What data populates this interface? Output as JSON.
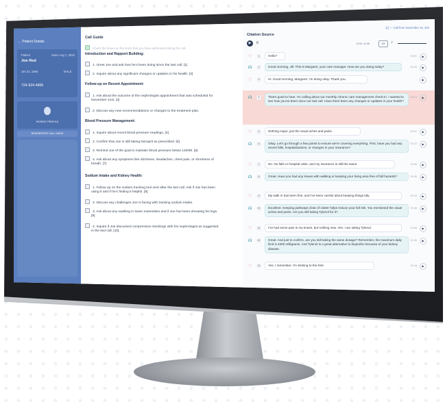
{
  "patient_panel": {
    "header": "Patient Details",
    "patient_label": "Patient",
    "patient_name": "Joe Red",
    "since": "Since Aug 7, 2024",
    "phone": "724-924-4865",
    "dob": "Jan 22, 1956",
    "gender": "MALE",
    "profile_label": "PATIENT PROFILE",
    "regen_label": "REGENERATE CALL GUIDE"
  },
  "call_guide": {
    "title": "Call Guide",
    "top_item": "Check the boxes as the items that you have addressed during the call",
    "sections": [
      {
        "heading": "Introduction and Rapport Building:",
        "items": [
          "1. Greet Joe and ask how he's been doing since the last call. [1]",
          "2. Inquire about any significant changes or updates in his health. [2]"
        ]
      },
      {
        "heading": "Follow-up on Recent Appointment:",
        "items": [
          "1. Ask about the outcome of the nephrologist appointment that was scheduled for",
          "November 21st. [3]",
          "2. Discuss any new recommendations or changes to the treatment plan."
        ]
      },
      {
        "heading": "Blood Pressure Management:",
        "items": [
          "1. Inquire about recent blood pressure readings. [4]",
          "2. Confirm that Joe is still taking lisinopril as prescribed. [5]",
          "3. Remind Joe of the goal to maintain blood pressure below 140/90. [6]",
          "4. Ask about any symptoms like dizziness, headaches, chest pain, or shortness of",
          "breath. [7]"
        ]
      },
      {
        "heading": "Sodium Intake and Kidney Health:",
        "items": [
          "1. Follow up on the sodium tracking tool sent after the last call. Ask if Joe has been",
          "using it and if he's finding it helpful. [8]",
          "2. Discuss any challenges Joe is facing with tracking sodium intake.",
          "3. Ask about any swelling in lower extremities and if Joe has been elevating his legs.",
          "[9]",
          "4. Inquire if Joe discussed compression stockings with his nephrologist as suggested",
          "in the last call. [10]"
        ]
      }
    ]
  },
  "citation": {
    "title": "Citation Source",
    "from": "[1] — Call from November 15, 202",
    "player": {
      "play": "▶",
      "pos": "0",
      "time": "0:00 / 6:26",
      "speed": "1X",
      "volume": "♪"
    },
    "messages": [
      {
        "n": "1",
        "who": "cust",
        "text": "Hello?",
        "t": "00:01"
      },
      {
        "n": "2",
        "who": "agent",
        "text": "Good morning, Jill. This is Margaret, your care manager. How are you doing today?",
        "t": "00:05"
      },
      {
        "n": "3",
        "who": "cust",
        "text": "Hi. Good morning, Margaret. I'm doing okay. Thank you.",
        "t": ""
      },
      {
        "n": "4",
        "who": "agent",
        "text": "That's good to hear. I'm calling about our monthly chronic care management check-in. I wanted to see how you've been since our last call. Have there been any changes or updates in your health?",
        "t": "00:10"
      },
      {
        "n": "5",
        "who": "cust",
        "text": "Nothing major, just the usual aches and pains.",
        "t": "00:22"
      },
      {
        "n": "6",
        "who": "agent",
        "text": "Okay. Let's go through a few points to ensure we're covering everything. First, have you had any recent falls, hospitalizations, or changes in your insurance?",
        "t": "00:23"
      },
      {
        "n": "7",
        "who": "cust",
        "text": "No. No falls or hospital visits, and my insurance is still the same.",
        "t": "00:30"
      },
      {
        "n": "8",
        "who": "agent",
        "text": "Great. Have you had any issues with walking or keeping your living area free of fall hazards?",
        "t": "00:36"
      },
      {
        "n": "9",
        "who": "cust",
        "text": "My walk in has been fine, and I've been careful about keeping things tidy.",
        "t": "00:44"
      },
      {
        "n": "10",
        "who": "agent",
        "text": "Excellent. Keeping pathways clear of clutter helps reduce your fall risk. You mentioned the usual aches and pains. Are you still taking Tylenol for it?",
        "t": "00:48"
      },
      {
        "n": "11",
        "who": "cust",
        "text": "I've had some pain in my knees, but nothing new. Yes. I am taking Tylenol.",
        "t": "00:59"
      },
      {
        "n": "12",
        "who": "agent",
        "text": "Great. And just to confirm, are you still taking the same dosage? Remember, the maximum daily limit is 4000 milligrams. And Tylenol is a great alternative to ibuprofen because of your kidney disease.",
        "t": "01:06"
      },
      {
        "n": "13",
        "who": "cust",
        "text": "Yes. I remember. I'm sticking to the limit.",
        "t": "01:18"
      }
    ]
  }
}
